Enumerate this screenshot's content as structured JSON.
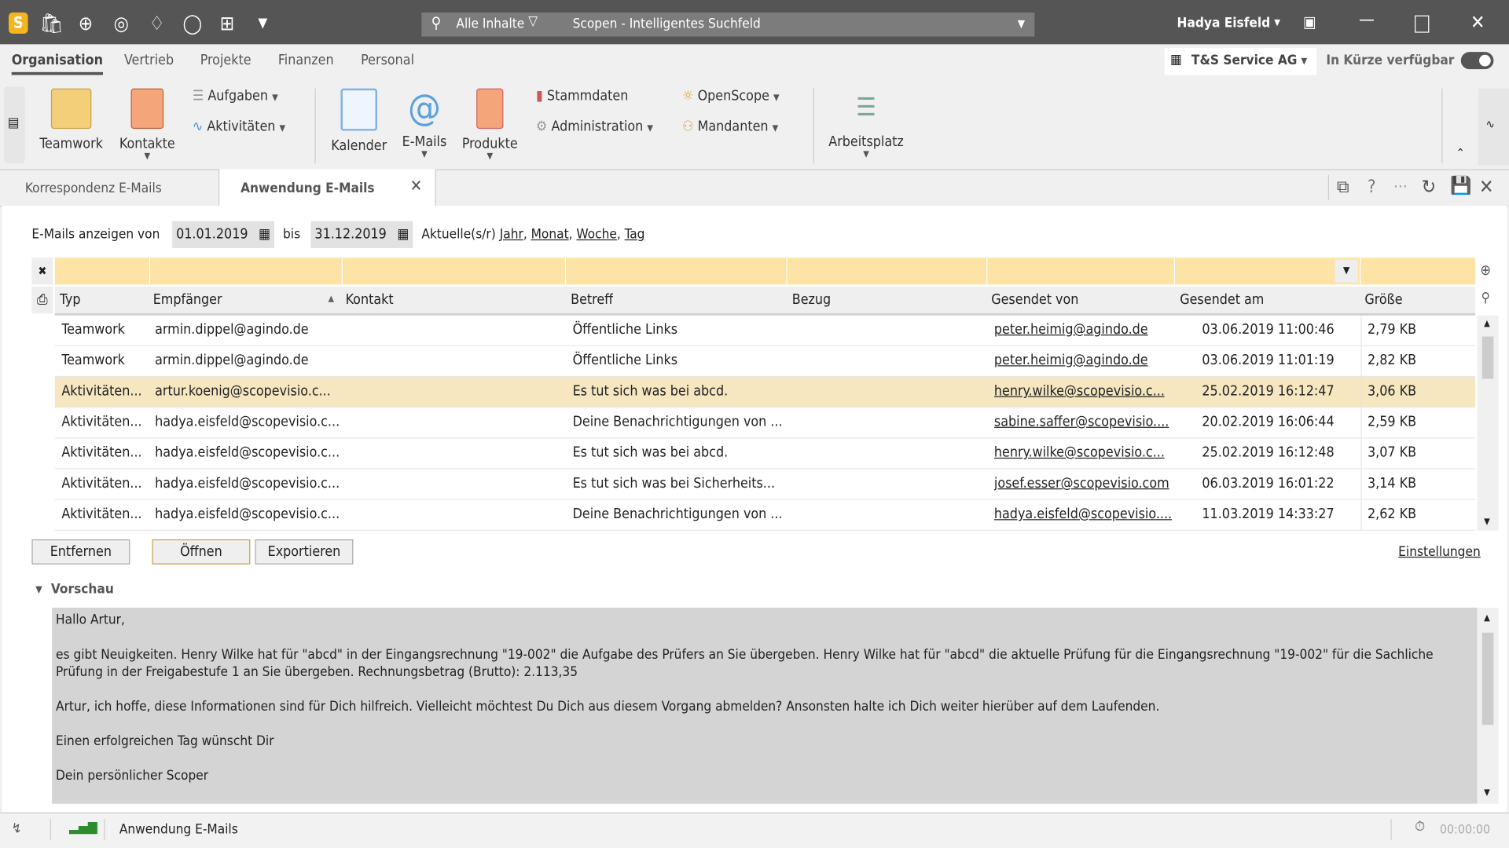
{
  "titlebar": {
    "search_scope": "Alle Inhalte",
    "search_placeholder": "Scopen - Intelligentes Suchfeld",
    "user": "Hadya Eisfeld"
  },
  "menu_tabs": [
    "Organisation",
    "Vertrieb",
    "Projekte",
    "Finanzen",
    "Personal"
  ],
  "company": "T&S Service AG",
  "availability": "In Kürze verfügbar",
  "availability_toggle": true,
  "ribbon": {
    "teamwork": "Teamwork",
    "kontakte": "Kontakte",
    "aufgaben": "Aufgaben",
    "aktivitaeten": "Aktivitäten",
    "kalender": "Kalender",
    "emails": "E-Mails",
    "produkte": "Produkte",
    "stammdaten": "Stammdaten",
    "administration": "Administration",
    "openscope": "OpenScope",
    "mandanten": "Mandanten",
    "arbeitsplatz": "Arbeitsplatz"
  },
  "doc_tabs": [
    {
      "label": "Korrespondenz E-Mails",
      "active": false
    },
    {
      "label": "Anwendung E-Mails",
      "active": true
    }
  ],
  "filter": {
    "label": "E-Mails anzeigen von",
    "from": "01.01.2019",
    "to_label": "bis",
    "to": "31.12.2019",
    "current_label": "Aktuelle(s/r)",
    "links": [
      "Jahr",
      "Monat",
      "Woche",
      "Tag"
    ]
  },
  "table": {
    "columns": [
      "Typ",
      "Empfänger",
      "Kontakt",
      "Betreff",
      "Bezug",
      "Gesendet von",
      "Gesendet am",
      "Größe"
    ],
    "rows": [
      [
        "Teamwork",
        "armin.dippel@agindo.de",
        "",
        "Öffentliche Links",
        "",
        "peter.heimig@agindo.de",
        "03.06.2019 11:00:46",
        "2,79 KB"
      ],
      [
        "Teamwork",
        "armin.dippel@agindo.de",
        "",
        "Öffentliche Links",
        "",
        "peter.heimig@agindo.de",
        "03.06.2019 11:01:19",
        "2,82 KB"
      ],
      [
        "Aktivitäten...",
        "artur.koenig@scopevisio.c...",
        "",
        "Es tut sich was bei abcd.",
        "",
        "henry.wilke@scopevisio.c...",
        "25.02.2019 16:12:47",
        "3,06 KB"
      ],
      [
        "Aktivitäten...",
        "hadya.eisfeld@scopevisio.c...",
        "",
        "Deine Benachrichtigungen von ...",
        "",
        "sabine.saffer@scopevisio....",
        "20.02.2019 16:06:44",
        "2,59 KB"
      ],
      [
        "Aktivitäten...",
        "hadya.eisfeld@scopevisio.c...",
        "",
        "Es tut sich was bei abcd.",
        "",
        "henry.wilke@scopevisio.c...",
        "25.02.2019 16:12:48",
        "3,07 KB"
      ],
      [
        "Aktivitäten...",
        "hadya.eisfeld@scopevisio.c...",
        "",
        "Es tut sich was bei Sicherheits...",
        "",
        "josef.esser@scopevisio.com",
        "06.03.2019 16:01:22",
        "3,14 KB"
      ],
      [
        "Aktivitäten...",
        "hadya.eisfeld@scopevisio.c...",
        "",
        "Deine Benachrichtigungen von ...",
        "",
        "hadya.eisfeld@scopevisio....",
        "11.03.2019 14:33:27",
        "2,62 KB"
      ]
    ],
    "selected_row": 2
  },
  "buttons": {
    "remove": "Entfernen",
    "open": "Öffnen",
    "export": "Exportieren",
    "settings": "Einstellungen"
  },
  "preview": {
    "title": "Vorschau",
    "paragraphs": [
      "Hallo Artur,",
      "es gibt Neuigkeiten. Henry Wilke hat für \"abcd\" in der Eingangsrechnung \"19-002\" die Aufgabe des Prüfers an Sie übergeben. Henry Wilke hat für \"abcd\" die aktuelle Prüfung für die Eingangsrechnung \"19-002\" für die Sachliche Prüfung in der Freigabestufe 1 an Sie übergeben. Rechnungsbetrag (Brutto): 2.113,35",
      "Artur, ich hoffe, diese Informationen sind für Dich hilfreich. Vielleicht möchtest Du Dich aus diesem Vorgang abmelden? Ansonsten halte ich Dich weiter hierüber auf dem Laufenden.",
      "Einen erfolgreichen Tag wünscht Dir",
      "Dein persönlicher Scoper"
    ]
  },
  "statusbar": {
    "label": "Anwendung E-Mails",
    "timer": "00:00:00"
  },
  "colors": {
    "titlebar": "#555555",
    "filter_row": "#fde3a5",
    "selected_row": "#f6e7c1",
    "logo": "#f5b51f"
  }
}
